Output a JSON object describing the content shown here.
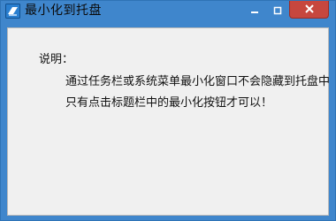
{
  "window": {
    "title": "最小化到托盘",
    "title_color": "#3f86cc",
    "icons": {
      "app": "app-icon",
      "minimize": "minimize-icon",
      "maximize": "maximize-icon",
      "close": "close-icon"
    }
  },
  "content": {
    "label": "说明：",
    "line1": "通过任务栏或系统菜单最小化窗口不会隐藏到托盘中",
    "line2": "只有点击标题栏中的最小化按钮才可以！"
  }
}
